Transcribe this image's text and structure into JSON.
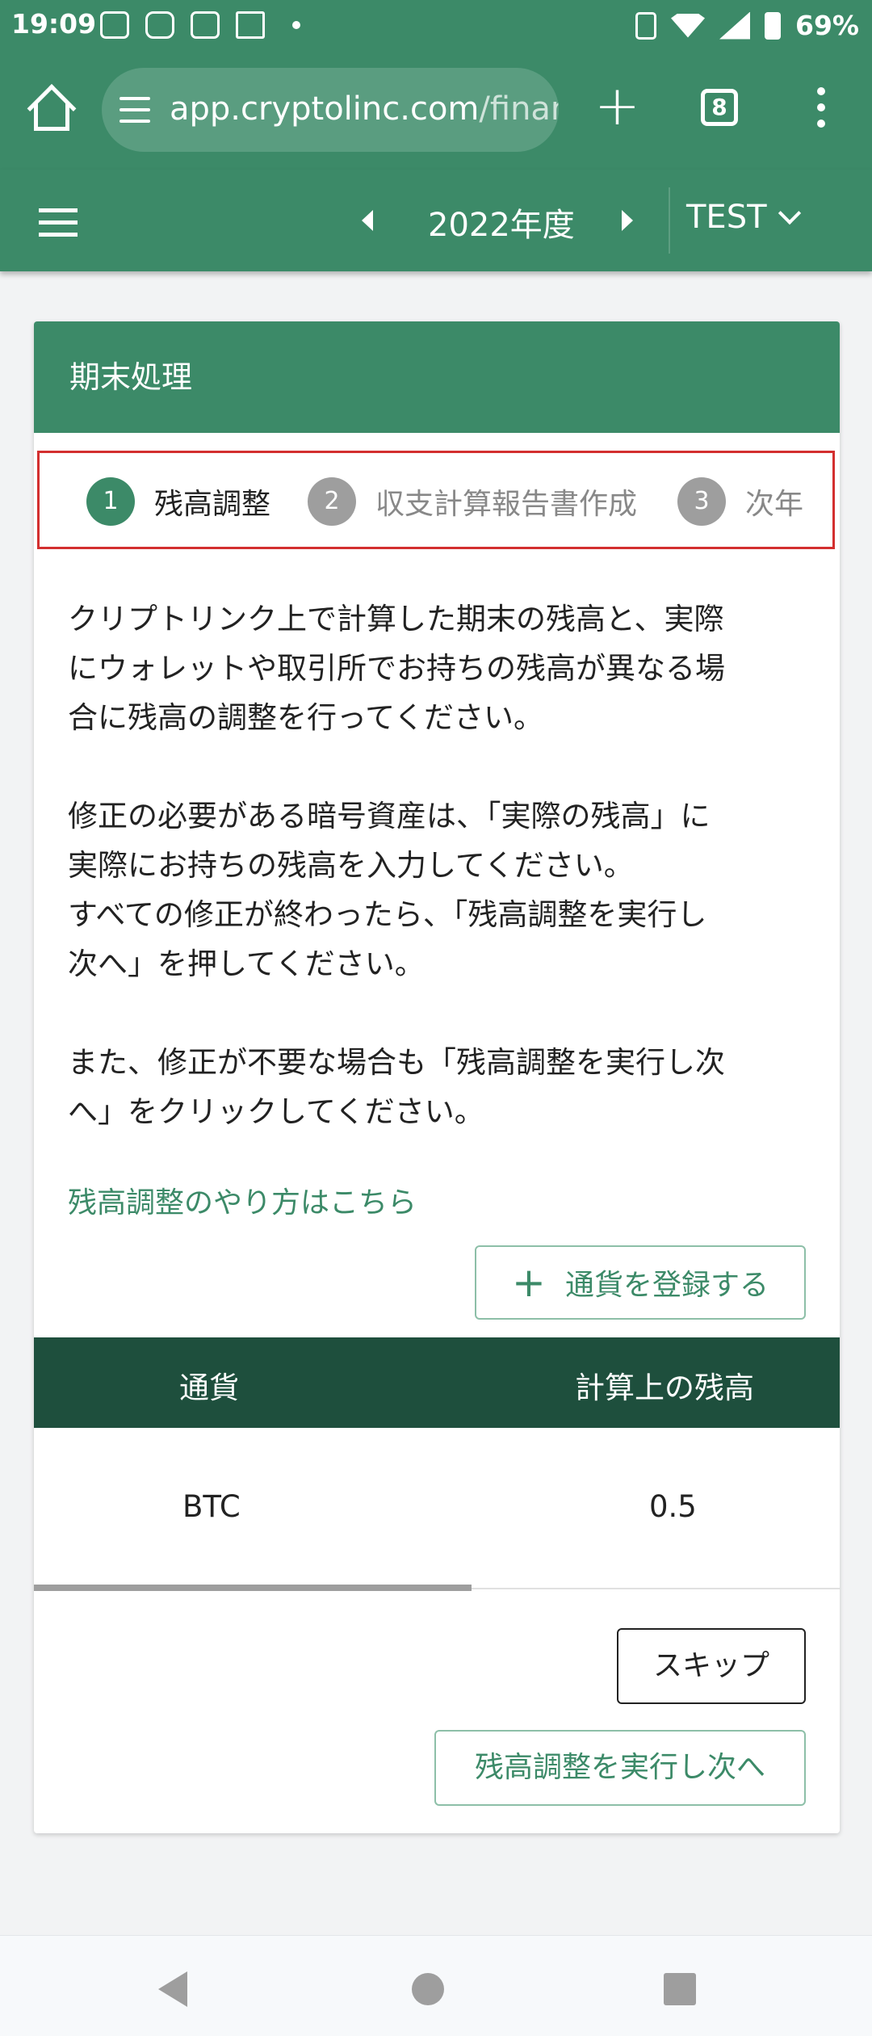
{
  "status_bar": {
    "time": "19:09",
    "battery": "69%",
    "icons": [
      "sim-icon",
      "instagram-icon",
      "tiktok-icon",
      "gmail-icon",
      "dot-icon",
      "vibrate-icon",
      "wifi-icon",
      "signal-icon",
      "battery-icon"
    ]
  },
  "browser": {
    "url_host": "app.cryptolinc.com",
    "url_rest": "/finar",
    "tab_count": "8",
    "new_tab_label": "+"
  },
  "app_bar": {
    "fiscal_year": "2022年度",
    "account": "TEST"
  },
  "card": {
    "title": "期末処理",
    "steps": [
      {
        "num": "1",
        "label": "残高調整"
      },
      {
        "num": "2",
        "label": "収支計算報告書作成"
      },
      {
        "num": "3",
        "label": "次年"
      }
    ],
    "description": {
      "p1_l1": "クリプトリンク上で計算した期末の残高と、実際",
      "p1_l2": "にウォレットや取引所でお持ちの残高が異なる場",
      "p1_l3": "合に残高の調整を行ってください。",
      "p2_l1": "修正の必要がある暗号資産は、「実際の残高」に",
      "p2_l2": "実際にお持ちの残高を入力してください。",
      "p2_l3": "すべての修正が終わったら、「残高調整を実行し",
      "p2_l4": "次へ」を押してください。",
      "p3_l1": "また、修正が不要な場合も「残高調整を実行し次",
      "p3_l2": "へ」をクリックしてください。"
    },
    "howto_link": "残高調整のやり方はこちら",
    "add_currency_button": "通貨を登録する",
    "table": {
      "headers": [
        "通貨",
        "計算上の残高"
      ],
      "rows": [
        {
          "currency": "BTC",
          "balance": "0.5"
        }
      ]
    },
    "skip_button": "スキップ",
    "next_button": "残高調整を実行し次へ"
  },
  "colors": {
    "primary": "#3c8a68",
    "table_header": "#1e4f3d",
    "highlight_border": "#d32f2f"
  }
}
